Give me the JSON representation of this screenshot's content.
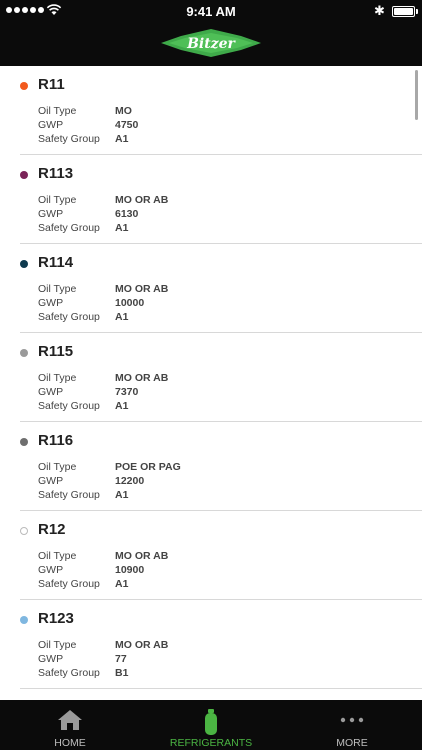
{
  "status_bar": {
    "time": "9:41 AM"
  },
  "brand": {
    "logo_text": "Bitzer",
    "accent": "#3faa4a"
  },
  "labels": {
    "oil_type": "Oil Type",
    "gwp": "GWP",
    "safety_group": "Safety Group"
  },
  "refrigerants": [
    {
      "name": "R11",
      "color": "#f25a1d",
      "oil_type": "MO",
      "gwp": "4750",
      "safety_group": "A1"
    },
    {
      "name": "R113",
      "color": "#7b2459",
      "oil_type": "MO OR AB",
      "gwp": "6130",
      "safety_group": "A1"
    },
    {
      "name": "R114",
      "color": "#0e3a4e",
      "oil_type": "MO OR AB",
      "gwp": "10000",
      "safety_group": "A1"
    },
    {
      "name": "R115",
      "color": "#9a9a9a",
      "oil_type": "MO OR AB",
      "gwp": "7370",
      "safety_group": "A1"
    },
    {
      "name": "R116",
      "color": "#6e6e6e",
      "oil_type": "POE OR PAG",
      "gwp": "12200",
      "safety_group": "A1"
    },
    {
      "name": "R12",
      "color": "#ffffff",
      "oil_type": "MO OR AB",
      "gwp": "10900",
      "safety_group": "A1"
    },
    {
      "name": "R123",
      "color": "#7fb7e0",
      "oil_type": "MO OR AB",
      "gwp": "77",
      "safety_group": "B1"
    }
  ],
  "tabs": [
    {
      "label": "HOME",
      "icon": "home-icon",
      "active": false
    },
    {
      "label": "REFRIGERANTS",
      "icon": "gas-cylinder-icon",
      "active": true
    },
    {
      "label": "MORE",
      "icon": "more-dots-icon",
      "active": false
    }
  ]
}
